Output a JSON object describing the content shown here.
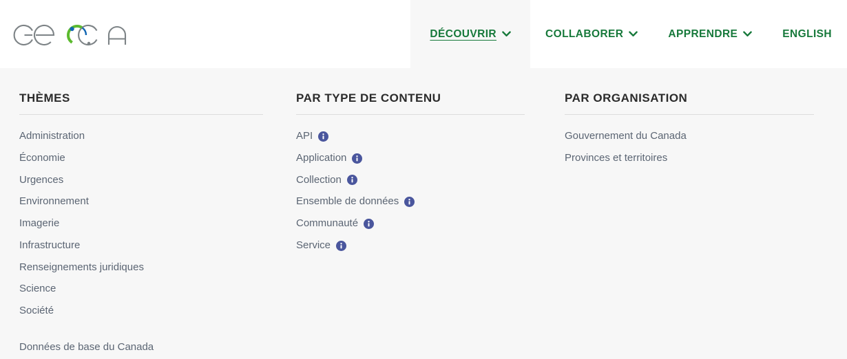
{
  "site": {
    "logo_text": "GEO.CA",
    "logo_colors": {
      "letters": "#7d8386",
      "blue": "#1267b3",
      "green": "#5cba2e"
    }
  },
  "header": {
    "accent_color": "#17793b",
    "active_tab_bg": "#f7f7f7",
    "nav": [
      {
        "label": "DÉCOUVRIR",
        "has_chevron": true,
        "active": true
      },
      {
        "label": "COLLABORER",
        "has_chevron": true,
        "active": false
      },
      {
        "label": "APPRENDRE",
        "has_chevron": true,
        "active": false
      },
      {
        "label": "ENGLISH",
        "has_chevron": false,
        "active": false
      }
    ]
  },
  "mega_menu": {
    "panel_bg": "#f7f7f7",
    "info_icon_color": "#4a569d",
    "columns": [
      {
        "title": "THÈMES",
        "items": [
          {
            "label": "Administration",
            "info": false
          },
          {
            "label": "Économie",
            "info": false
          },
          {
            "label": "Urgences",
            "info": false
          },
          {
            "label": "Environnement",
            "info": false
          },
          {
            "label": "Imagerie",
            "info": false
          },
          {
            "label": "Infrastructure",
            "info": false
          },
          {
            "label": "Renseignements juridiques",
            "info": false
          },
          {
            "label": "Science",
            "info": false
          },
          {
            "label": "Société",
            "info": false
          }
        ],
        "extra_items": [
          {
            "label": "Données de base du Canada",
            "info": false
          }
        ]
      },
      {
        "title": "PAR TYPE DE CONTENU",
        "items": [
          {
            "label": "API",
            "info": true
          },
          {
            "label": "Application",
            "info": true
          },
          {
            "label": "Collection",
            "info": true
          },
          {
            "label": "Ensemble de données",
            "info": true
          },
          {
            "label": "Communauté",
            "info": true
          },
          {
            "label": "Service",
            "info": true
          }
        ],
        "extra_items": []
      },
      {
        "title": "PAR ORGANISATION",
        "items": [
          {
            "label": "Gouvernement du Canada",
            "info": false
          },
          {
            "label": "Provinces et territoires",
            "info": false
          }
        ],
        "extra_items": []
      }
    ]
  }
}
